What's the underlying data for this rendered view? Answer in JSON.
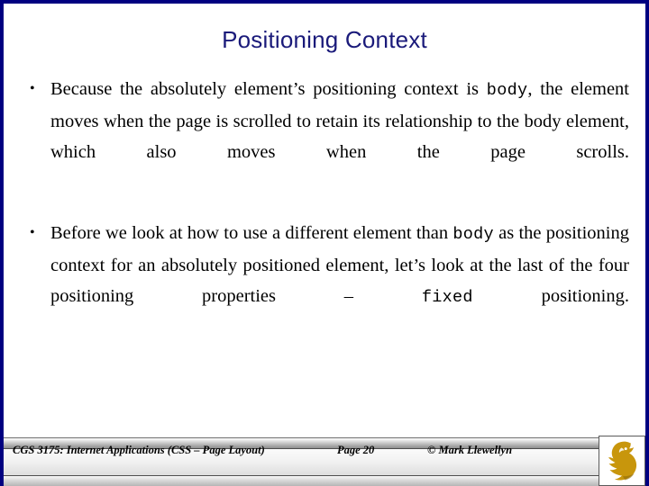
{
  "slide": {
    "title": "Positioning Context",
    "border_color": "#000080",
    "title_color": "#1a1a7a",
    "background": "#ffffff"
  },
  "content": {
    "bullet_marker": "•",
    "bullets": [
      {
        "id": "bullet-1",
        "parts": [
          {
            "type": "text",
            "value": "Because the absolutely element’s positioning context is "
          },
          {
            "type": "code",
            "value": "body"
          },
          {
            "type": "text",
            "value": ", the element moves when the page is scrolled to retain its relationship to the body element, which also moves when the page scrolls."
          }
        ]
      },
      {
        "id": "bullet-2",
        "parts": [
          {
            "type": "text",
            "value": "Before we look at how to use a different element than "
          },
          {
            "type": "code",
            "value": "body"
          },
          {
            "type": "text",
            "value": " as the positioning context for an absolutely positioned element, let’s look at the last of the four positioning properties – "
          },
          {
            "type": "code",
            "value": "fixed"
          },
          {
            "type": "text",
            "value": " positioning."
          }
        ]
      }
    ]
  },
  "footer": {
    "course": "CGS 3175: Internet Applications (CSS – Page Layout)",
    "page": "Page 20",
    "author": "© Mark Llewellyn",
    "logo_name": "ucf-pegasus-logo",
    "logo_color": "#C8960C",
    "logo_shadow": "#8a6708"
  }
}
